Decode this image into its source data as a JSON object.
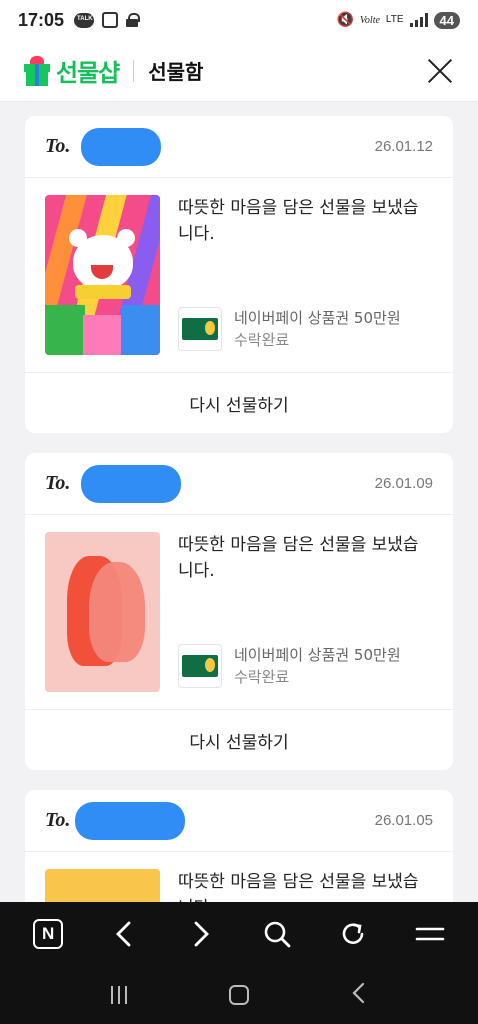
{
  "status": {
    "time": "17:05",
    "talk_label": "TALK",
    "volte": "Volte",
    "lte": "LTE",
    "battery": "44"
  },
  "appbar": {
    "logo_text": "선물샵",
    "title": "선물함"
  },
  "gifts": [
    {
      "to": "To.",
      "date": "26.01.12",
      "message": "따뜻한 마음을 담은 선물을 보냈습니다.",
      "product": "네이버페이 상품권 50만원",
      "status": "수락완료",
      "regift": "다시 선물하기"
    },
    {
      "to": "To.",
      "date": "26.01.09",
      "message": "따뜻한 마음을 담은 선물을 보냈습니다.",
      "product": "네이버페이 상품권 50만원",
      "status": "수락완료",
      "regift": "다시 선물하기"
    },
    {
      "to": "To.",
      "date": "26.01.05",
      "message": "따뜻한 마음을 담은 선물을 보냈습니다."
    }
  ],
  "bottom_nav": [
    "naver-home",
    "back",
    "forward",
    "search",
    "refresh",
    "menu"
  ]
}
